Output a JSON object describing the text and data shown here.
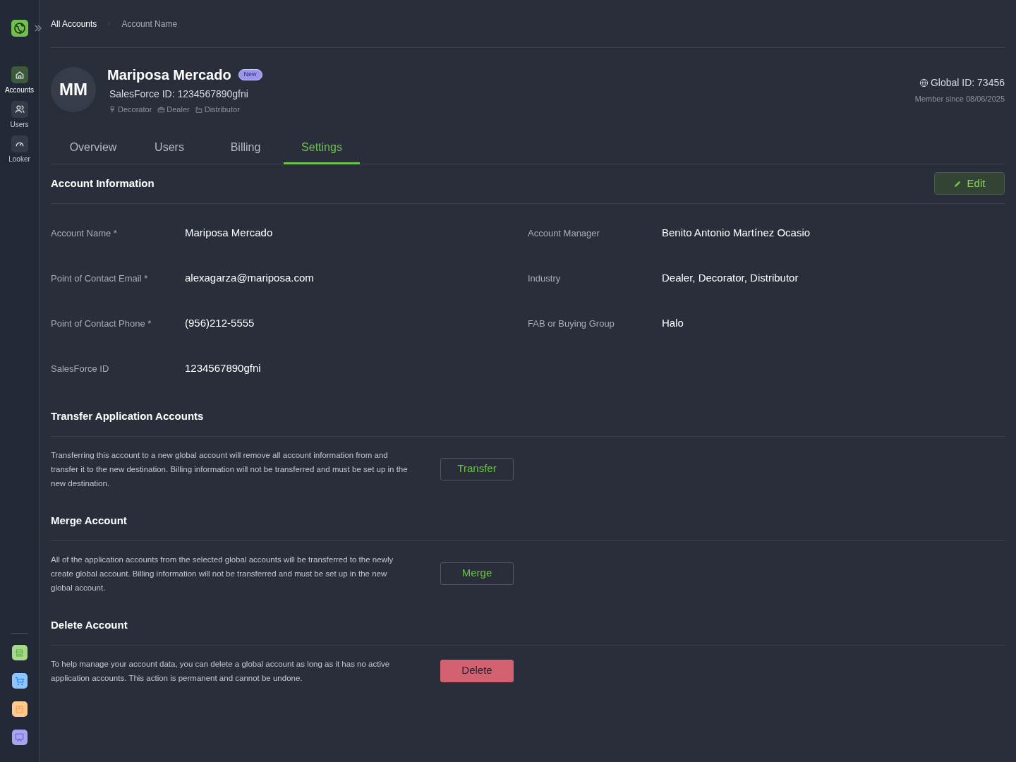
{
  "sidebar": {
    "items": [
      {
        "label": "Accounts",
        "selected": true
      },
      {
        "label": "Users",
        "selected": false
      },
      {
        "label": "Looker",
        "selected": false
      }
    ],
    "apps": [
      {
        "color": "#a6d98a"
      },
      {
        "color": "#8ec5ff"
      },
      {
        "color": "#ffc98f"
      },
      {
        "color": "#a9a5ec"
      }
    ]
  },
  "breadcrumb": [
    "All Accounts",
    "Account Name"
  ],
  "account": {
    "initials": "MM",
    "name": "Mariposa Mercado",
    "badge": "New",
    "salesforce": "SalesForce ID: 1234567890gfni",
    "types": [
      {
        "label": "Decorator"
      },
      {
        "label": "Dealer"
      },
      {
        "label": "Distributor"
      }
    ],
    "global_id": "Global ID: 73456",
    "member_since": "Member since 08/06/2025"
  },
  "tabs": [
    {
      "label": "Overview",
      "selected": false
    },
    {
      "label": "Users",
      "selected": false
    },
    {
      "label": "Billing",
      "selected": false
    },
    {
      "label": "Settings",
      "selected": true
    }
  ],
  "info": {
    "title": "Account Information",
    "edit": "Edit",
    "left": [
      {
        "label": "Account Name *",
        "value": "Mariposa Mercado"
      },
      {
        "label": "Point of Contact Email *",
        "value": "alexagarza@mariposa.com"
      },
      {
        "label": "Point of Contact Phone *",
        "value": "(956)212-5555"
      },
      {
        "label": "SalesForce ID",
        "value": "1234567890gfni"
      }
    ],
    "right": [
      {
        "label": "Account Manager",
        "value": "Benito Antonio Martínez Ocasio"
      },
      {
        "label": "Industry",
        "value": "Dealer, Decorator, Distributor"
      },
      {
        "label": "FAB or Buying Group",
        "value": "Halo"
      }
    ]
  },
  "sections": [
    {
      "title": "Transfer Application Accounts",
      "text": "Transferring this account to a new global account will remove all account information from and transfer it to the new destination. Billing information will not be transferred and must be set up in the new destination.",
      "button": "Transfer",
      "kind": "outline"
    },
    {
      "title": "Merge Account",
      "text": "All of the application accounts from the selected global accounts will be transferred to the newly create global account. Billing information will not be transferred and must be set up in the new global account.",
      "button": "Merge",
      "kind": "outline"
    },
    {
      "title": "Delete Account",
      "text": "To help manage your account data, you can delete a global account as long as it has no active application accounts. This action is permanent and cannot be undone.",
      "button": "Delete",
      "kind": "danger"
    }
  ]
}
